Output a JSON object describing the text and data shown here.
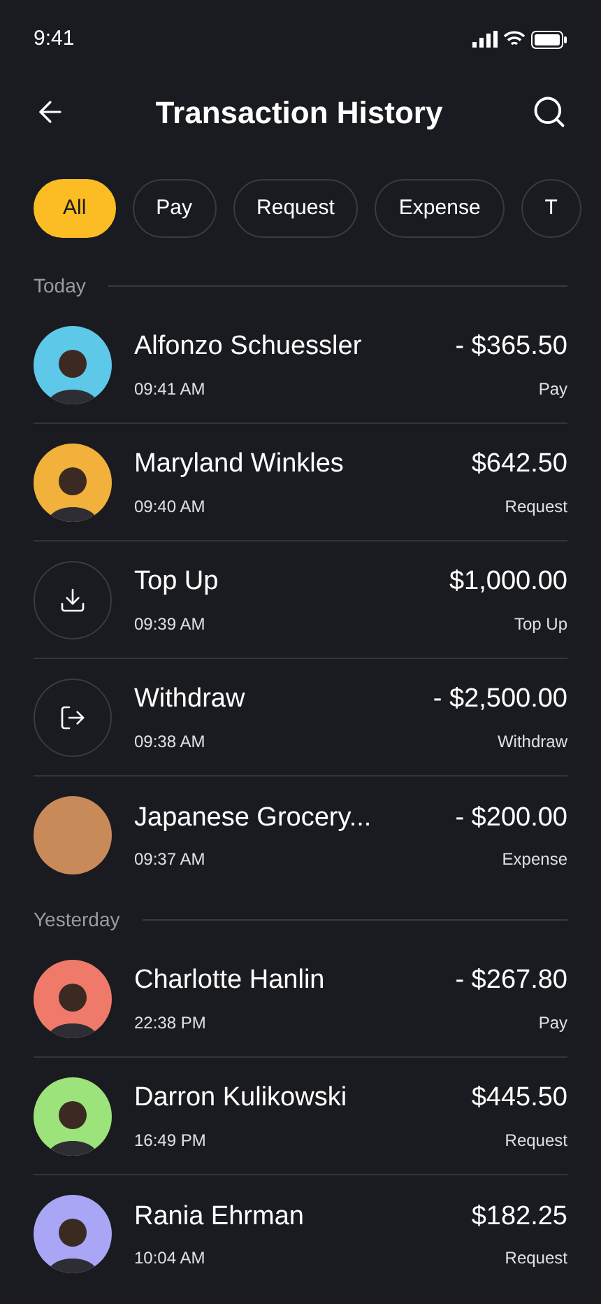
{
  "status_bar": {
    "time": "9:41"
  },
  "header": {
    "title": "Transaction History"
  },
  "filters": [
    {
      "label": "All",
      "selected": true
    },
    {
      "label": "Pay",
      "selected": false
    },
    {
      "label": "Request",
      "selected": false
    },
    {
      "label": "Expense",
      "selected": false
    },
    {
      "label": "T",
      "selected": false
    }
  ],
  "groups": [
    {
      "label": "Today",
      "transactions": [
        {
          "kind": "person",
          "color": "#5ec8e8",
          "name": "Alfonzo Schuessler",
          "time": "09:41 AM",
          "amount": "- $365.50",
          "type": "Pay"
        },
        {
          "kind": "person",
          "color": "#f2b13a",
          "name": "Maryland Winkles",
          "time": "09:40 AM",
          "amount": "$642.50",
          "type": "Request"
        },
        {
          "kind": "topup",
          "name": "Top Up",
          "time": "09:39 AM",
          "amount": "$1,000.00",
          "type": "Top Up"
        },
        {
          "kind": "withdraw",
          "name": "Withdraw",
          "time": "09:38 AM",
          "amount": "- $2,500.00",
          "type": "Withdraw"
        },
        {
          "kind": "photo",
          "name": "Japanese Grocery...",
          "time": "09:37 AM",
          "amount": "- $200.00",
          "type": "Expense"
        }
      ]
    },
    {
      "label": "Yesterday",
      "transactions": [
        {
          "kind": "person",
          "color": "#f07a6a",
          "name": "Charlotte Hanlin",
          "time": "22:38 PM",
          "amount": "- $267.80",
          "type": "Pay"
        },
        {
          "kind": "person",
          "color": "#9be37a",
          "name": "Darron Kulikowski",
          "time": "16:49 PM",
          "amount": "$445.50",
          "type": "Request"
        },
        {
          "kind": "person",
          "color": "#a8a6f5",
          "name": "Rania Ehrman",
          "time": "10:04 AM",
          "amount": "$182.25",
          "type": "Request"
        }
      ]
    }
  ]
}
